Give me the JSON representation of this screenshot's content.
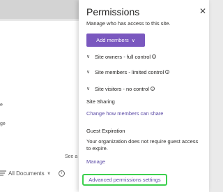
{
  "background": {
    "fragments": [
      "e",
      "ge",
      "See a"
    ],
    "toolbar": {
      "view_label": "All Documents",
      "dropdown_glyph": "∨",
      "info_glyph": "i"
    }
  },
  "panel": {
    "title": "Permissions",
    "close_glyph": "✕",
    "description": "Manage who has access to this site.",
    "add_members": {
      "label": "Add members",
      "chevron": "∨"
    },
    "groups": [
      {
        "label": "Site owners - full control",
        "chevron": "∨",
        "info_glyph": "i"
      },
      {
        "label": "Site members - limited control",
        "chevron": "∨",
        "info_glyph": "i"
      },
      {
        "label": "Site visitors - no control",
        "chevron": "∨",
        "info_glyph": "i"
      }
    ],
    "site_sharing": {
      "heading": "Site Sharing",
      "link": "Change how members can share"
    },
    "guest_expiration": {
      "heading": "Guest Expiration",
      "text": "Your organization does not require guest access to expire.",
      "link": "Manage"
    },
    "advanced_link": "Advanced permissions settings"
  },
  "colors": {
    "accent": "#7a58bf",
    "link": "#5b4aa6",
    "highlight": "#3ccf4e"
  }
}
